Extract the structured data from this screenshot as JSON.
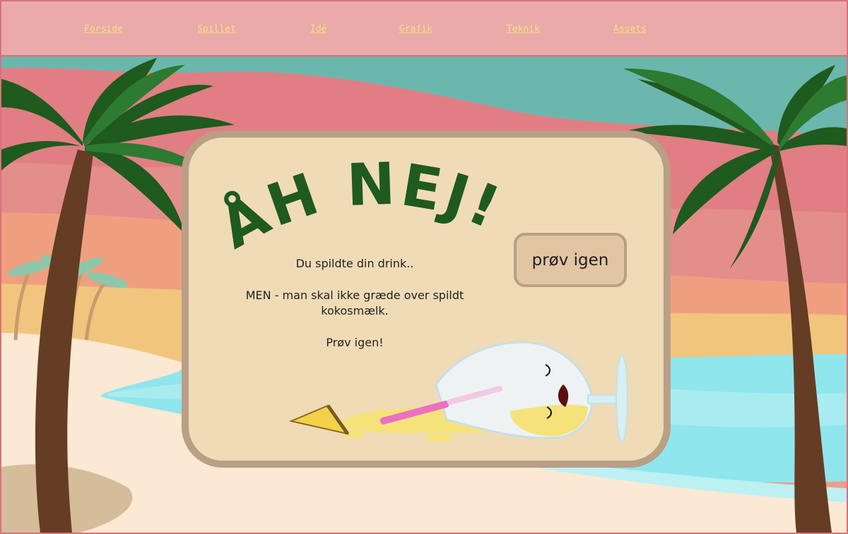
{
  "nav": {
    "items": [
      {
        "label": "Forside"
      },
      {
        "label": "Spillet"
      },
      {
        "label": "Idé"
      },
      {
        "label": "Grafik"
      },
      {
        "label": "Teknik"
      },
      {
        "label": "Assets"
      }
    ]
  },
  "popup": {
    "headline": "ÅH NEJ!",
    "line1": "Du spildte din drink..",
    "line2a": "MEN - man skal ikke græde over spildt",
    "line2b": "kokosmælk.",
    "line3": "Prøv igen!",
    "retry_button": "prøv igen"
  },
  "colors": {
    "nav_bg": "#eaaaaa",
    "nav_link": "#f6e27b",
    "card_bg": "#f0dbb7",
    "card_border": "#b99f86",
    "headline": "#1f5a1f",
    "palm_leaf": "#1f5a1f",
    "sea": "#8fe6ec",
    "sand": "#fbe9d3"
  }
}
